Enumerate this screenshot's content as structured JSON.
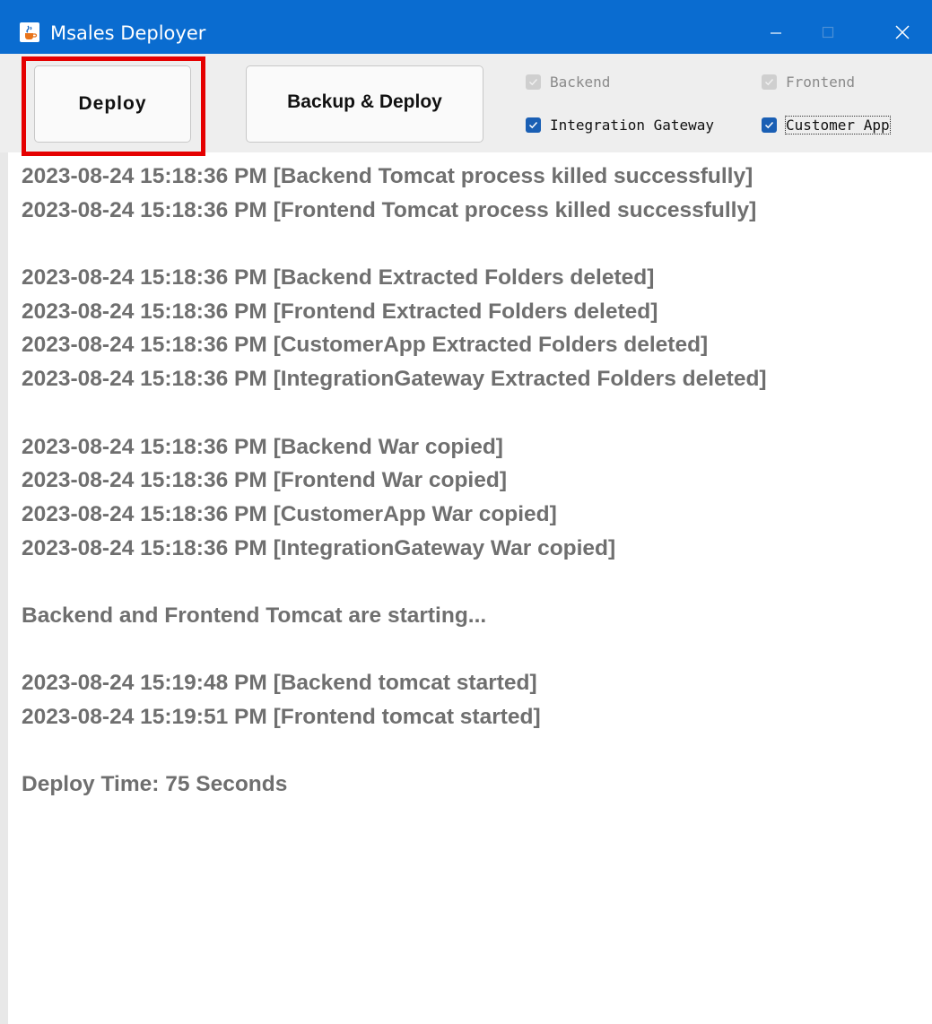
{
  "window": {
    "title": "Msales Deployer",
    "icon": "java-cup-icon",
    "controls": [
      "minimize-icon",
      "maximize-icon",
      "close-icon"
    ],
    "titlebar_color": "#0a6cd0"
  },
  "toolbar": {
    "deploy_label": "Deploy",
    "backup_deploy_label": "Backup & Deploy",
    "highlight_color": "#e50000",
    "checkboxes": [
      {
        "label": "Backend",
        "checked": true,
        "enabled": false
      },
      {
        "label": "Frontend",
        "checked": true,
        "enabled": false
      },
      {
        "label": "Integration Gateway",
        "checked": true,
        "enabled": true
      },
      {
        "label": "Customer App",
        "checked": true,
        "enabled": true,
        "focused": true
      }
    ]
  },
  "log": {
    "text_color": "#6f6f6f",
    "lines": [
      "2023-08-24 15:18:36 PM [Backend Tomcat process killed successfully]",
      "2023-08-24 15:18:36 PM [Frontend Tomcat process killed successfully]",
      "",
      "2023-08-24 15:18:36 PM [Backend Extracted Folders deleted]",
      "2023-08-24 15:18:36 PM [Frontend Extracted Folders deleted]",
      "2023-08-24 15:18:36 PM [CustomerApp Extracted Folders deleted]",
      "2023-08-24 15:18:36 PM [IntegrationGateway Extracted Folders deleted]",
      "",
      "2023-08-24 15:18:36 PM [Backend War copied]",
      "2023-08-24 15:18:36 PM [Frontend War copied]",
      "2023-08-24 15:18:36 PM [CustomerApp War copied]",
      "2023-08-24 15:18:36 PM [IntegrationGateway War copied]",
      "",
      "Backend and Frontend Tomcat are starting...",
      "",
      "2023-08-24 15:19:48 PM [Backend tomcat started]",
      "2023-08-24 15:19:51 PM [Frontend tomcat started]",
      "",
      "Deploy Time: 75 Seconds"
    ]
  }
}
